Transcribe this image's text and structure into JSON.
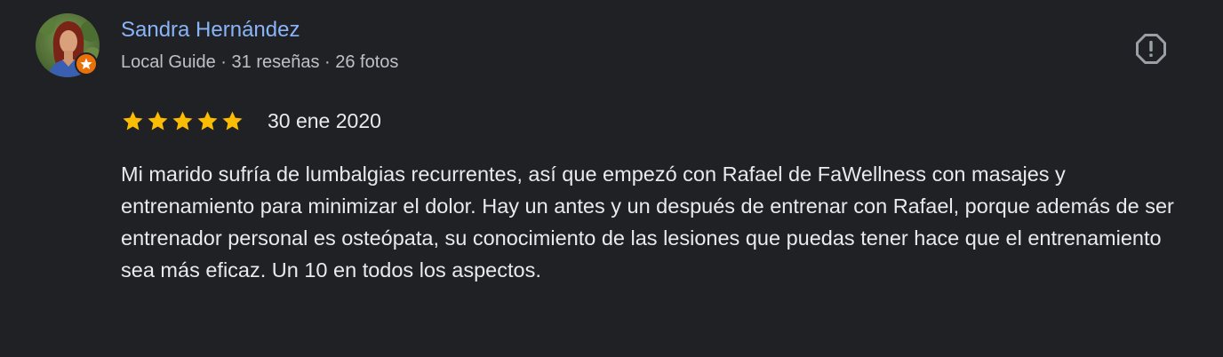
{
  "reviewer": {
    "name": "Sandra Hernández",
    "meta": "Local Guide · 31 reseñas · 26 fotos"
  },
  "icons": {
    "avatar": "avatar-photo",
    "guide_badge": "local-guide-star-icon",
    "report": "report-octagon-icon",
    "star": "star-icon"
  },
  "rating": {
    "stars": 5,
    "max_stars": 5,
    "date": "30 ene 2020"
  },
  "review": {
    "text": "Mi marido sufría de lumbalgias recurrentes, así que empezó con Rafael de FaWellness con masajes y entrenamiento para minimizar el dolor. Hay un antes y un después de entrenar con Rafael, porque además de ser entrenador personal es osteópata, su conocimiento de las lesiones que puedas tener hace que el entrenamiento sea más eficaz. Un 10 en todos los aspectos."
  },
  "colors": {
    "background": "#202124",
    "name_link": "#8ab4f8",
    "secondary_text": "#bdc1c6",
    "primary_text": "#e8eaed",
    "star": "#fbbc04",
    "guide_badge": "#e8710a",
    "report_icon": "#9aa0a6"
  }
}
